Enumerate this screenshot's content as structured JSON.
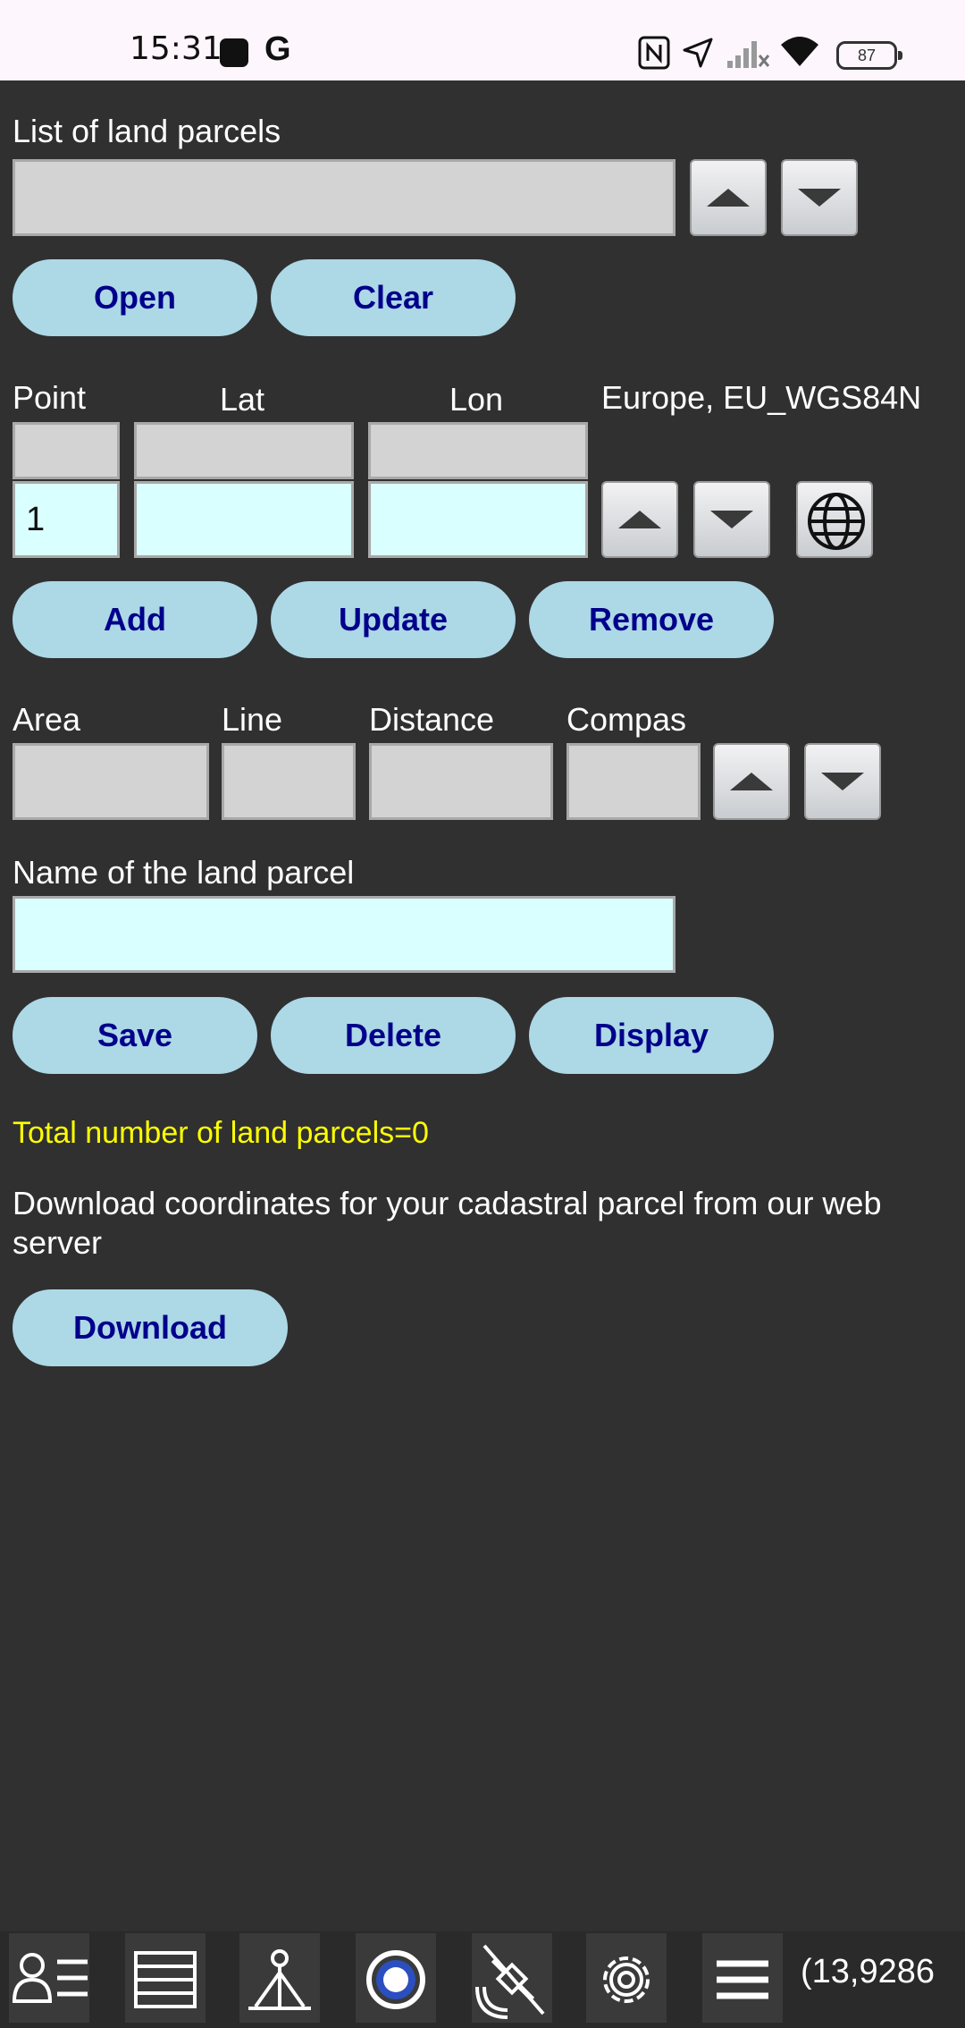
{
  "status_bar": {
    "time": "15:31",
    "battery": "87",
    "icons": [
      "stop-square-icon",
      "google-icon",
      "nfc-icon",
      "location-arrow-icon",
      "signal-off-icon",
      "wifi-icon",
      "battery-icon"
    ]
  },
  "parcels": {
    "list_label": "List of land parcels",
    "open_label": "Open",
    "clear_label": "Clear"
  },
  "points": {
    "point_header": "Point",
    "lat_header": "Lat",
    "lon_header": "Lon",
    "datum_label": "Europe, EU_WGS84N",
    "point_value": "1",
    "add_label": "Add",
    "update_label": "Update",
    "remove_label": "Remove"
  },
  "measure": {
    "area_label": "Area",
    "line_label": "Line",
    "distance_label": "Distance",
    "compas_label": "Compas"
  },
  "name": {
    "label": "Name of the land parcel",
    "save_label": "Save",
    "delete_label": "Delete",
    "display_label": "Display"
  },
  "summary": {
    "total_text": "Total number of land parcels=0",
    "download_info": "Download coordinates for your cadastral parcel from our web server",
    "download_label": "Download"
  },
  "toolbar": {
    "coord_text": "(13,9286",
    "icons": [
      "user-list-icon",
      "list-view-icon",
      "survey-tripod-icon",
      "record-icon",
      "satellite-off-icon",
      "settings-icon",
      "menu-icon"
    ]
  },
  "colors": {
    "background": "#303031",
    "button_bg": "#add8e6",
    "button_text": "#00008b",
    "input_readonly": "#d3d3d3",
    "input_editable": "#d9ffff",
    "summary_text": "#ffff00"
  }
}
